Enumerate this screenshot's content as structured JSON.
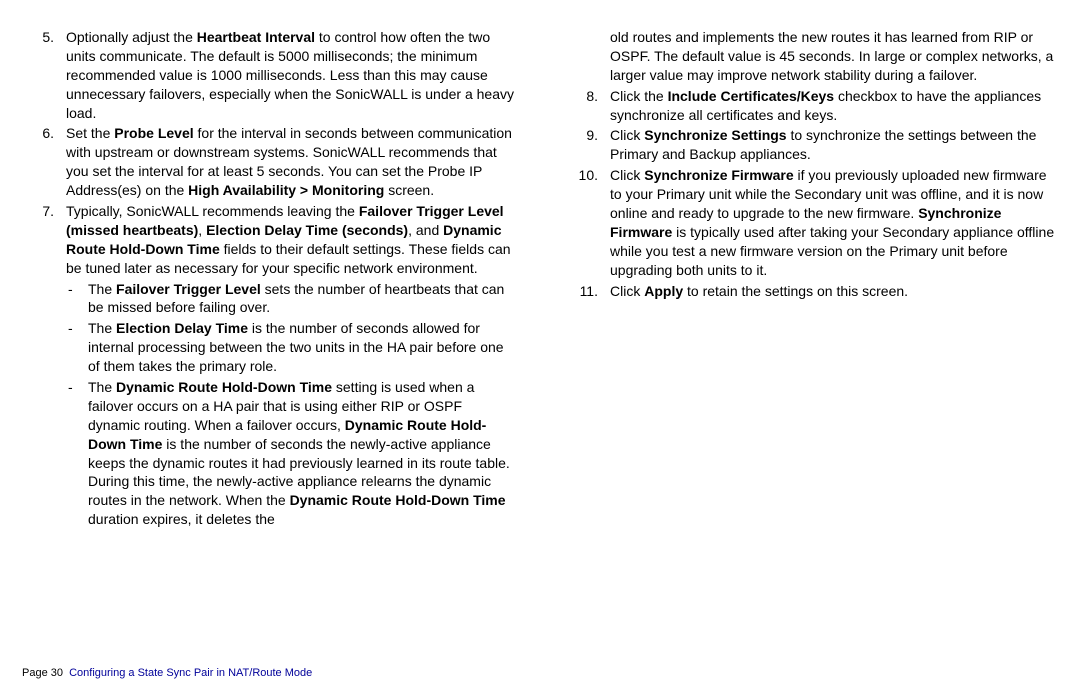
{
  "left": {
    "i5_num": "5.",
    "i5_prefix": "Optionally adjust the ",
    "i5_b1": "Heartbeat Interval",
    "i5_rest": " to control how often the two units communicate. The default is 5000 milliseconds; the minimum recommended value is 1000 milliseconds. Less than this may cause unnecessary failovers, especially when the SonicWALL is under a heavy load.",
    "i6_num": "6.",
    "i6_prefix": "Set the ",
    "i6_b1": "Probe Level",
    "i6_mid": " for the interval in seconds between communication with upstream or downstream systems. SonicWALL recommends that you set the interval for at least 5 seconds. You can set the Probe IP Address(es) on the ",
    "i6_b2": "High Availability > Monitoring",
    "i6_end": " screen.",
    "i7_num": "7.",
    "i7_prefix": "Typically, SonicWALL recommends leaving the ",
    "i7_b1": "Failover Trigger Level (missed heartbeats)",
    "i7_sep1": ", ",
    "i7_b2": "Election Delay Time (seconds)",
    "i7_sep2": ", and ",
    "i7_b3": "Dynamic Route Hold-Down Time",
    "i7_end": " fields to their default settings. These fields can be tuned later as necessary for your specific network environment.",
    "s1_dash": "-",
    "s1_pre": "The ",
    "s1_b": "Failover Trigger Level",
    "s1_end": " sets the number of heartbeats that can be missed before failing over.",
    "s2_dash": "-",
    "s2_pre": "The ",
    "s2_b": "Election Delay Time",
    "s2_end": " is the number of seconds allowed for internal processing between the two units in the HA pair before one of them takes the primary role.",
    "s3_dash": "-",
    "s3_pre": "The ",
    "s3_b1": "Dynamic Route Hold-Down Time",
    "s3_mid1": " setting is used when a failover occurs on a HA pair that is using either RIP or OSPF dynamic routing. When a failover occurs, ",
    "s3_b2": "Dynamic Route Hold-Down Time",
    "s3_mid2": " is the number of seconds the newly-active appliance keeps the dynamic routes it had previously learned in its route table. During this time, the newly-active appliance relearns the dynamic routes in the network. When the ",
    "s3_b3": "Dynamic Route Hold-Down Time",
    "s3_end": " duration expires, it deletes the"
  },
  "right": {
    "cont": "old routes and implements the new routes it has learned from RIP or OSPF. The default value is 45 seconds. In large or complex networks, a larger value may improve network stability during a failover.",
    "i8_num": "8.",
    "i8_pre": "Click the ",
    "i8_b": "Include Certificates/Keys",
    "i8_end": " checkbox to have the appliances synchronize all certificates and keys.",
    "i9_num": "9.",
    "i9_pre": "Click ",
    "i9_b": "Synchronize Settings",
    "i9_end": " to synchronize the settings between the Primary and Backup appliances.",
    "i10_num": "10.",
    "i10_pre": "Click ",
    "i10_b1": "Synchronize Firmware",
    "i10_mid": " if you previously uploaded new firmware to your Primary unit while the Secondary unit was offline, and it is now online and ready to upgrade to the new firmware. ",
    "i10_b2": "Synchronize Firmware",
    "i10_end": " is typically used after taking your Secondary appliance offline while you test a new firmware version on the Primary unit before upgrading both units to it.",
    "i11_num": "11.",
    "i11_pre": "Click ",
    "i11_b": "Apply",
    "i11_end": " to retain the settings on this screen."
  },
  "footer": {
    "page_label": "Page 30",
    "section": "Configuring a State Sync Pair in NAT/Route Mode"
  }
}
